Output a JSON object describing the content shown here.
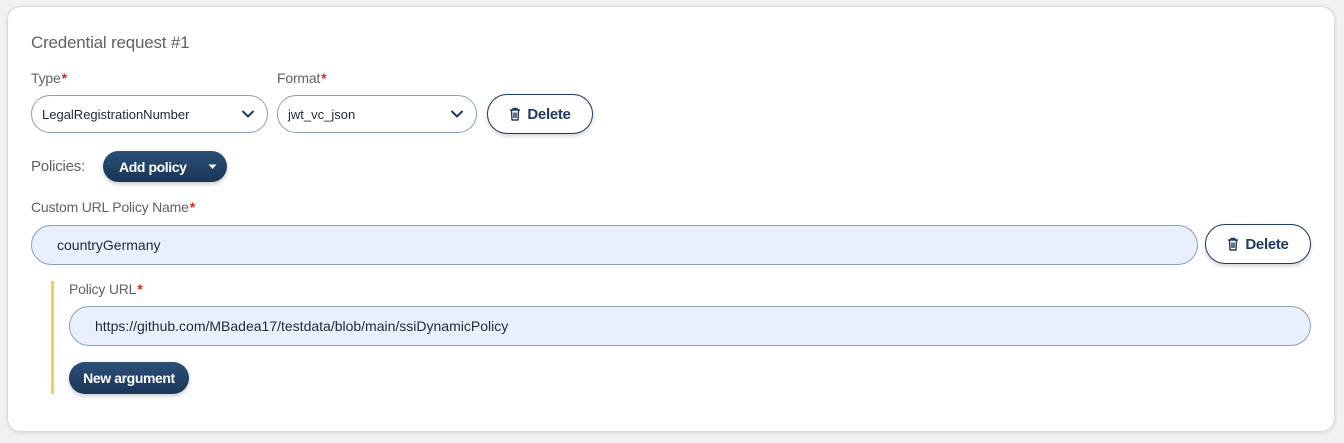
{
  "card": {
    "title": "Credential request #1",
    "type_label": "Type",
    "format_label": "Format",
    "required_marker": "*",
    "type_value": "LegalRegistrationNumber",
    "format_value": "jwt_vc_json",
    "delete_label": "Delete",
    "policies_label": "Policies:",
    "add_policy_label": "Add policy",
    "custom_policy_name_label": "Custom URL Policy Name",
    "custom_policy_name_value": "countryGermany",
    "policy_delete_label": "Delete",
    "policy_url_label": "Policy URL",
    "policy_url_value": "https://github.com/MBadea17/testdata/blob/main/ssiDynamicPolicy",
    "new_argument_label": "New argument"
  },
  "icons": {
    "chevron": "chevron-down-icon",
    "trash": "trash-icon",
    "caret": "caret-down-icon"
  },
  "colors": {
    "primary": "#1f3a5c",
    "required": "#e02424",
    "input_bg": "#e8f0fe",
    "accent_bar": "#f5cf4d"
  }
}
